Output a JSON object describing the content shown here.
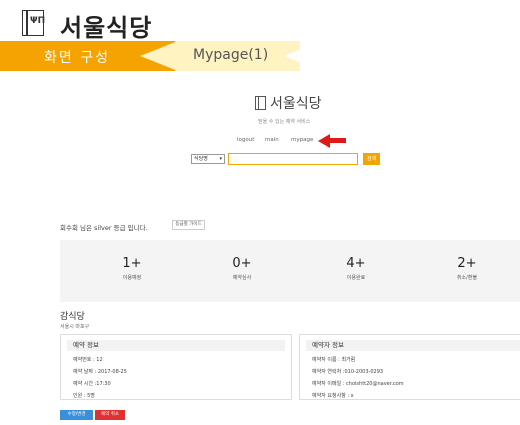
{
  "header": {
    "title": "서울식당",
    "logo_glyph": "ΨΠ",
    "section": "화면 구성",
    "page": "Mypage(1)"
  },
  "site": {
    "title": "서울식당",
    "subtitle": "믿을 수 있는 예약 서비스",
    "nav": [
      "logout",
      "main",
      "mypage"
    ],
    "search": {
      "select_value": "식당명",
      "placeholder": "",
      "button": "검색"
    }
  },
  "grade": {
    "text": "회수회 님은 silver 등급 입니다.",
    "guide_button": "등급별 가이드"
  },
  "stats": [
    {
      "num": "1+",
      "label": "이용예정"
    },
    {
      "num": "0+",
      "label": "예약심사"
    },
    {
      "num": "4+",
      "label": "이용완료"
    },
    {
      "num": "2+",
      "label": "취소/환불"
    }
  ],
  "store": {
    "name": "감식당",
    "address": "서울시 마포구"
  },
  "reservation": {
    "title": "예약 정보",
    "rows": [
      "예약번호 : 12",
      "예약 날짜 : 2017-08-25",
      "예약 시간 :17:30",
      "인원 : 5명"
    ]
  },
  "reserver": {
    "title": "예약자 정보",
    "rows": [
      "예약자 이름 : 최거럼",
      "예약자 연락처 :010-2003-0293",
      "예약자 이메일 : choishtt20@naver.com",
      "예약자 요청사항 : x"
    ]
  },
  "actions": {
    "edit": "수정/변경",
    "cancel": "예약 취소"
  },
  "colors": {
    "accent": "#f5a300",
    "arrow": "#e01818",
    "edit": "#3b8fd9",
    "cancel": "#e03030"
  }
}
